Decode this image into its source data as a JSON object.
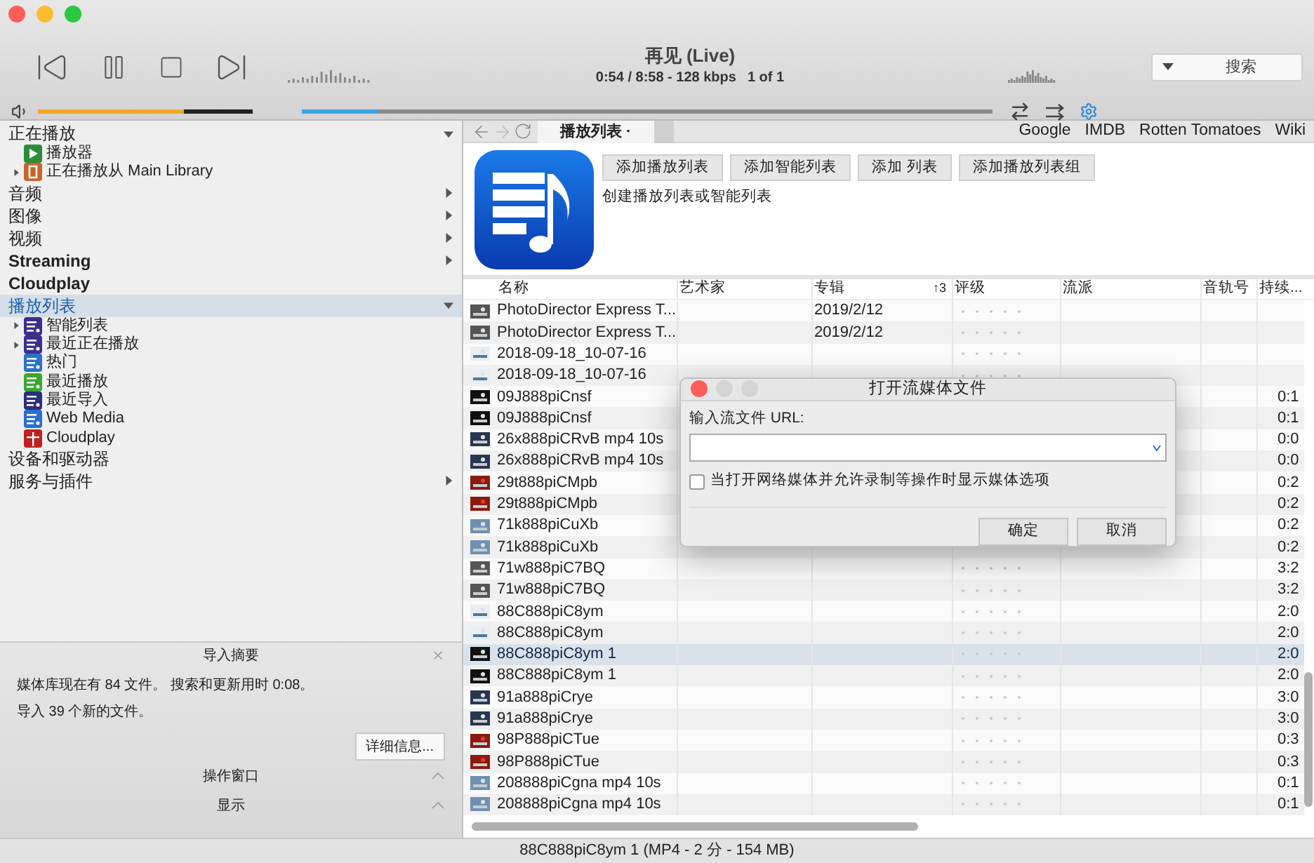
{
  "player": {
    "title": "再见 (Live)",
    "info": "0:54 / 8:58 - 128 kbps",
    "count": "1 of 1",
    "volume": {
      "level": 0.68
    },
    "progress": {
      "level": 0.11
    },
    "search": {
      "placeholder": "搜索"
    }
  },
  "sidebar": {
    "sections": [
      {
        "label": "正在播放",
        "kind": "cjk",
        "expandable": true,
        "expanded": true,
        "selected": false,
        "children": [
          {
            "label": "播放器",
            "kind": "play",
            "expandable": false
          },
          {
            "label": "正在播放从 Main Library",
            "kind": "doc",
            "expandable": true
          }
        ]
      },
      {
        "label": "音频",
        "kind": "cjk",
        "expandable": true,
        "expanded": false,
        "selected": false
      },
      {
        "label": "图像",
        "kind": "cjk",
        "expandable": true,
        "expanded": false,
        "selected": false
      },
      {
        "label": "视频",
        "kind": "cjk",
        "expandable": true,
        "expanded": false,
        "selected": false
      },
      {
        "label": "Streaming",
        "kind": "latin",
        "expandable": true,
        "expanded": false,
        "selected": false
      },
      {
        "label": "Cloudplay",
        "kind": "latin",
        "expandable": false,
        "selected": false
      },
      {
        "label": "播放列表",
        "kind": "cjk",
        "expandable": true,
        "expanded": true,
        "selected": true,
        "children": [
          {
            "label": "智能列表",
            "kind": "smart",
            "expandable": true
          },
          {
            "label": "最近正在播放",
            "kind": "smart",
            "expandable": true
          },
          {
            "label": "热门",
            "kind": "hot",
            "expandable": false
          },
          {
            "label": "最近播放",
            "kind": "recent",
            "expandable": false
          },
          {
            "label": "最近导入",
            "kind": "import",
            "expandable": false
          },
          {
            "label": "Web Media",
            "kind": "web",
            "expandable": false
          },
          {
            "label": "Cloudplay",
            "kind": "cloud",
            "expandable": false
          }
        ]
      },
      {
        "label": "设备和驱动器",
        "kind": "cjk",
        "expandable": false,
        "selected": false
      },
      {
        "label": "服务与插件",
        "kind": "cjk",
        "expandable": true,
        "expanded": false,
        "selected": false
      }
    ],
    "summary": {
      "title": "导入摘要",
      "lines": [
        "媒体库现在有 84 文件。 搜索和更新用时 0:08。",
        "导入 39 个新的文件。"
      ],
      "button": "详细信息..."
    },
    "panels": [
      {
        "label": "操作窗口",
        "expanded": false
      },
      {
        "label": "显示",
        "expanded": false
      }
    ]
  },
  "tabs": [
    {
      "label": "播放列表 ·",
      "selected": true
    }
  ],
  "links": [
    "Google",
    "IMDB",
    "Rotten Tomatoes",
    "Wiki"
  ],
  "playlist_header": {
    "buttons": [
      "添加播放列表",
      "添加智能列表",
      "添加 列表",
      "添加播放列表组"
    ],
    "description": "创建播放列表或智能列表"
  },
  "table": {
    "columns": [
      "名称",
      "艺术家",
      "专辑",
      "评级",
      "流派",
      "音轨号",
      "持续..."
    ],
    "sort_indicator": "↑3",
    "rows": [
      {
        "name": "PhotoDirector Express T...",
        "album": "2019/2/12",
        "stars": 0,
        "selected": false
      },
      {
        "name": "PhotoDirector Express T...",
        "album": "2019/2/12",
        "stars": 0,
        "selected": false
      },
      {
        "name": "2018-09-18_10-07-16",
        "stars": 0,
        "selected": false
      },
      {
        "name": "2018-09-18_10-07-16",
        "stars": 0,
        "selected": false
      },
      {
        "name": "09J888piCnsf",
        "duration": "0:1",
        "selected": false
      },
      {
        "name": "09J888piCnsf",
        "duration": "0:1",
        "selected": false
      },
      {
        "name": "26x888piCRvB mp4 10s",
        "duration": "0:0",
        "selected": false
      },
      {
        "name": "26x888piCRvB mp4 10s",
        "duration": "0:0",
        "selected": false
      },
      {
        "name": "29t888piCMpb",
        "duration": "0:2",
        "selected": false
      },
      {
        "name": "29t888piCMpb",
        "duration": "0:2",
        "selected": false
      },
      {
        "name": "71k888piCuXb",
        "duration": "0:2",
        "selected": false
      },
      {
        "name": "71k888piCuXb",
        "duration": "0:2",
        "selected": false
      },
      {
        "name": "71w888piC7BQ",
        "duration": "3:2",
        "stars": 0,
        "selected": false
      },
      {
        "name": "71w888piC7BQ",
        "duration": "3:2",
        "stars": 0,
        "selected": false
      },
      {
        "name": "88C888piC8ym",
        "duration": "2:0",
        "stars": 0,
        "selected": false
      },
      {
        "name": "88C888piC8ym",
        "duration": "2:0",
        "stars": 0,
        "selected": false
      },
      {
        "name": "88C888piC8ym 1",
        "duration": "2:0",
        "stars": 0,
        "selected": true
      },
      {
        "name": "88C888piC8ym 1",
        "duration": "2:0",
        "stars": 0,
        "selected": false
      },
      {
        "name": "91a888piCrye",
        "duration": "3:0",
        "stars": 0,
        "selected": false
      },
      {
        "name": "91a888piCrye",
        "duration": "3:0",
        "stars": 0,
        "selected": false
      },
      {
        "name": "98P888piCTue",
        "duration": "0:3",
        "stars": 0,
        "selected": false
      },
      {
        "name": "98P888piCTue",
        "duration": "0:3",
        "stars": 0,
        "selected": false
      },
      {
        "name": "208888piCgna mp4 10s",
        "duration": "0:1",
        "stars": 0,
        "selected": false
      },
      {
        "name": "208888piCgna mp4 10s",
        "duration": "0:1",
        "stars": 0,
        "selected": false
      }
    ]
  },
  "status_bar": "88C888piC8ym 1 (MP4 - 2 分 - 154 MB)",
  "dialog": {
    "title": "打开流媒体文件",
    "label": "输入流文件 URL:",
    "checkbox": {
      "label": "当打开网络媒体并允许录制等操作时显示媒体选项",
      "checked": false
    },
    "buttons": [
      "确定",
      "取消"
    ]
  }
}
